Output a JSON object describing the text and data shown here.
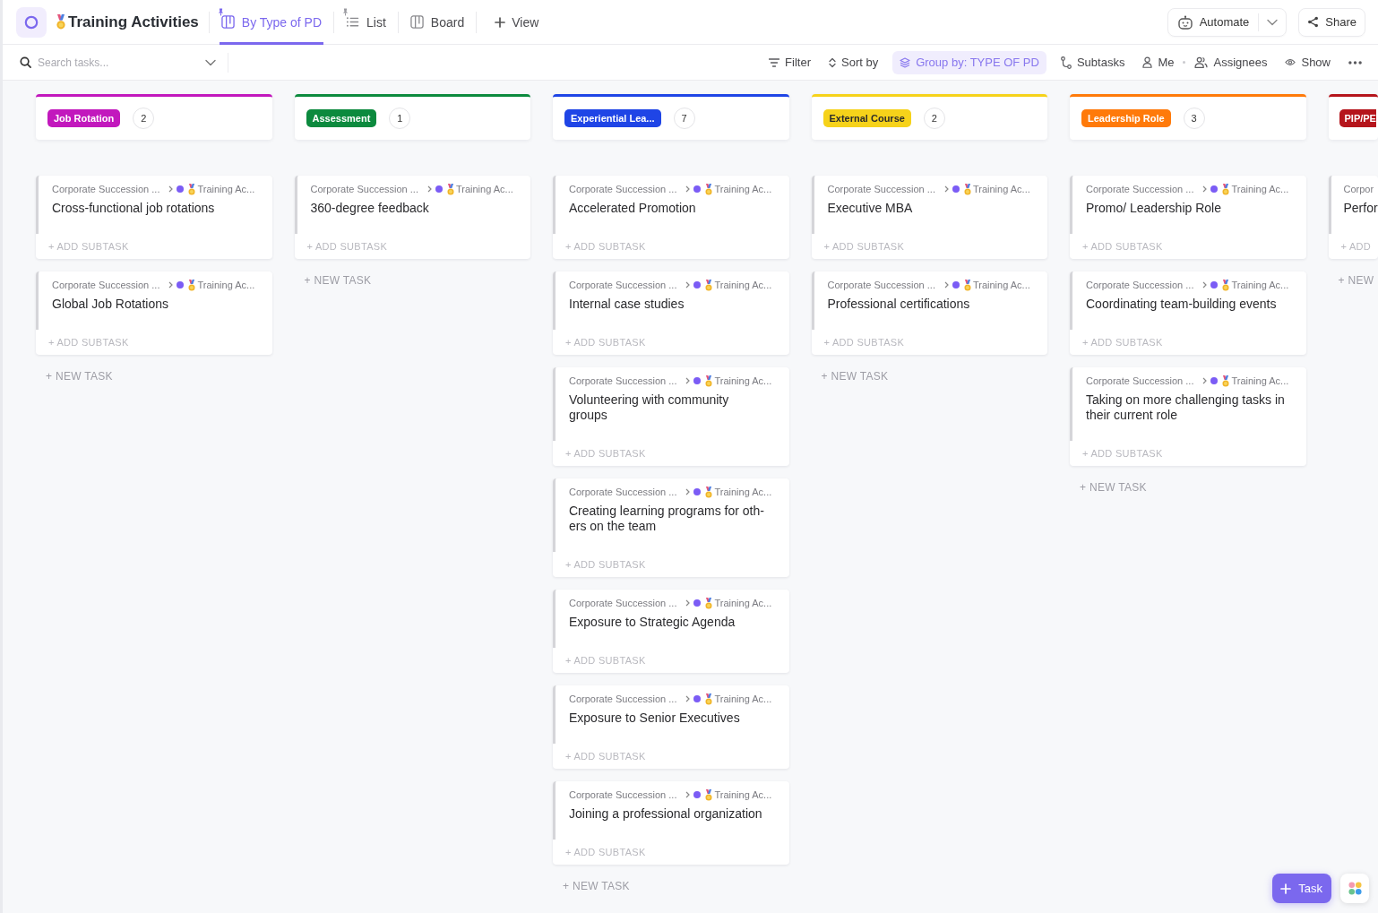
{
  "space": {
    "title": "Training Activities"
  },
  "views": [
    {
      "label": "By Type of PD",
      "kind": "board",
      "pinned": true,
      "selected": true
    },
    {
      "label": "List",
      "kind": "list",
      "pinned": true,
      "selected": false
    },
    {
      "label": "Board",
      "kind": "board",
      "pinned": false,
      "selected": false
    }
  ],
  "add_view": "View",
  "actions": [
    {
      "label": "Automate",
      "kind": "automate"
    },
    {
      "label": "Share",
      "kind": "share"
    }
  ],
  "search": {
    "placeholder": "Search tasks..."
  },
  "toolbar": [
    {
      "label": "Filter",
      "kind": "filter",
      "active": false
    },
    {
      "label": "Sort by",
      "kind": "sort",
      "active": false
    },
    {
      "label": "Group by: TYPE OF PD",
      "kind": "group",
      "active": true
    },
    {
      "label": "Subtasks",
      "kind": "subtasks",
      "active": false
    },
    {
      "label": "Me",
      "kind": "me",
      "active": false
    },
    {
      "label": "Assignees",
      "kind": "assignees",
      "active": false
    },
    {
      "label": "Show",
      "kind": "show",
      "active": false
    },
    {
      "kind": "more",
      "active": false
    }
  ],
  "columns": [
    {
      "tag": "Job Rotation",
      "color": "#c218bd",
      "count": "2",
      "cards": [
        {
          "path": "Corporate Succession ...",
          "list": "Training Ac...",
          "title": "Cross-functional job rotations",
          "add_subtask": "+ ADD SUBTASK"
        },
        {
          "path": "Corporate Succession ...",
          "list": "Training Ac...",
          "title": "Global Job Rotations",
          "add_subtask": "+ ADD SUBTASK"
        }
      ],
      "new_task": "+ NEW TASK"
    },
    {
      "tag": "Assessment",
      "color": "#0c8a3e",
      "count": "1",
      "cards": [
        {
          "path": "Corporate Succession ...",
          "list": "Training Ac...",
          "title": "360-degree feedback",
          "add_subtask": "+ ADD SUBTASK"
        }
      ],
      "new_task": "+ NEW TASK"
    },
    {
      "tag": "Experiential Lea...",
      "color": "#1f45e6",
      "count": "7",
      "cards": [
        {
          "path": "Corporate Succession ...",
          "list": "Training Ac...",
          "title": "Accelerated Promotion",
          "add_subtask": "+ ADD SUBTASK"
        },
        {
          "path": "Corporate Succession ...",
          "list": "Training Ac...",
          "title": "Internal case studies",
          "add_subtask": "+ ADD SUBTASK"
        },
        {
          "path": "Corporate Succession ...",
          "list": "Training Ac...",
          "title": "Volunteering with community groups",
          "add_subtask": "+ ADD SUBTASK"
        },
        {
          "path": "Corporate Succession ...",
          "list": "Training Ac...",
          "title": "Creating learning programs for oth-ers on the team",
          "add_subtask": "+ ADD SUBTASK"
        },
        {
          "path": "Corporate Succession ...",
          "list": "Training Ac...",
          "title": "Exposure to Strategic Agenda",
          "add_subtask": "+ ADD SUBTASK"
        },
        {
          "path": "Corporate Succession ...",
          "list": "Training Ac...",
          "title": "Exposure to Senior Executives",
          "add_subtask": "+ ADD SUBTASK"
        },
        {
          "path": "Corporate Succession ...",
          "list": "Training Ac...",
          "title": "Joining a professional organization",
          "add_subtask": "+ ADD SUBTASK"
        }
      ],
      "new_task": "+ NEW TASK"
    },
    {
      "tag": "External Course",
      "color": "#f6d21a",
      "count": "2",
      "cards": [
        {
          "path": "Corporate Succession ...",
          "list": "Training Ac...",
          "title": "Executive MBA",
          "add_subtask": "+ ADD SUBTASK"
        },
        {
          "path": "Corporate Succession ...",
          "list": "Training Ac...",
          "title": "Professional certifications",
          "add_subtask": "+ ADD SUBTASK"
        }
      ],
      "new_task": "+ NEW TASK"
    },
    {
      "tag": "Leadership Role",
      "color": "#ff7a0a",
      "count": "3",
      "cards": [
        {
          "path": "Corporate Succession ...",
          "list": "Training Ac...",
          "title": "Promo/ Leadership Role",
          "add_subtask": "+ ADD SUBTASK"
        },
        {
          "path": "Corporate Succession ...",
          "list": "Training Ac...",
          "title": "Coordinating team-building events",
          "add_subtask": "+ ADD SUBTASK"
        },
        {
          "path": "Corporate Succession ...",
          "list": "Training Ac...",
          "title": "Taking on more challenging tasks in their current role",
          "add_subtask": "+ ADD SUBTASK"
        }
      ],
      "new_task": "+ NEW TASK"
    },
    {
      "tag": "PIP/PE",
      "color": "#b5151c",
      "cards": [
        {
          "path": "Corpor",
          "title": "Perfor",
          "add_subtask": "+ ADD"
        }
      ],
      "new_task": "+ NEW"
    }
  ],
  "fab": {
    "label": "Task"
  }
}
